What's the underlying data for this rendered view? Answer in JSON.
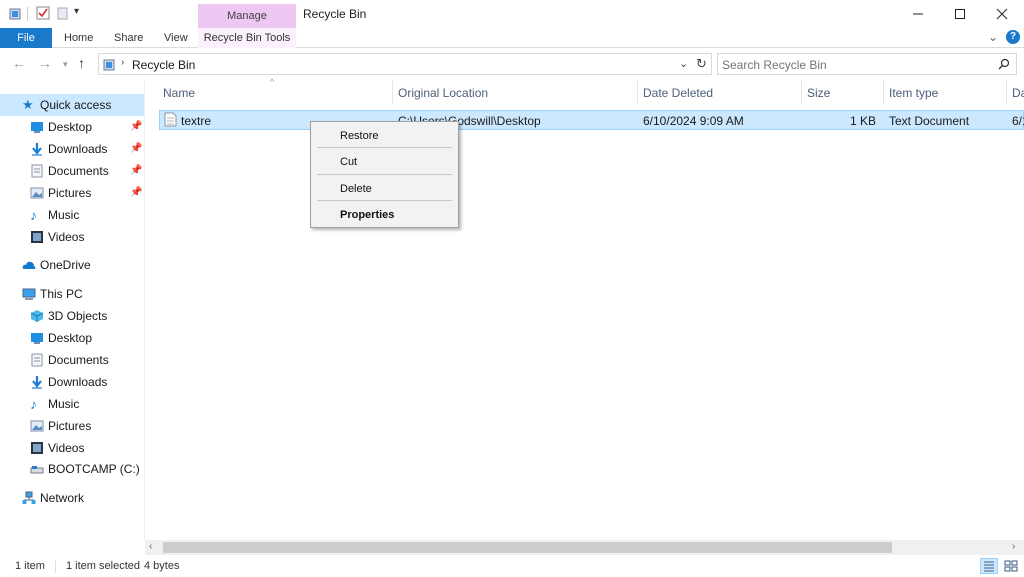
{
  "window": {
    "title": "Recycle Bin",
    "manage_label": "Manage",
    "tools_label": "Recycle Bin Tools"
  },
  "ribbon": {
    "file": "File",
    "home": "Home",
    "share": "Share",
    "view": "View"
  },
  "address": {
    "path": "Recycle Bin",
    "search_placeholder": "Search Recycle Bin"
  },
  "sidebar": {
    "quick_access": "Quick access",
    "qa_items": [
      "Desktop",
      "Downloads",
      "Documents",
      "Pictures",
      "Music",
      "Videos"
    ],
    "onedrive": "OneDrive",
    "this_pc": "This PC",
    "pc_items": [
      "3D Objects",
      "Desktop",
      "Documents",
      "Downloads",
      "Music",
      "Pictures",
      "Videos",
      "BOOTCAMP (C:)"
    ],
    "network": "Network"
  },
  "columns": {
    "name": "Name",
    "original_location": "Original Location",
    "date_deleted": "Date Deleted",
    "size": "Size",
    "item_type": "Item type",
    "date_modified": "Da"
  },
  "file": {
    "name": "textre",
    "original_location": "C:\\Users\\Godswill\\Desktop",
    "date_deleted": "6/10/2024 9:09 AM",
    "size": "1 KB",
    "item_type": "Text Document",
    "date_modified": "6/1"
  },
  "context_menu": {
    "restore": "Restore",
    "cut": "Cut",
    "delete": "Delete",
    "properties": "Properties"
  },
  "status": {
    "count": "1 item",
    "selected": "1 item selected",
    "size": "4 bytes"
  },
  "colors": {
    "accent": "#1979ca",
    "manage": "#efc7f3",
    "selection": "#cce8ff"
  }
}
